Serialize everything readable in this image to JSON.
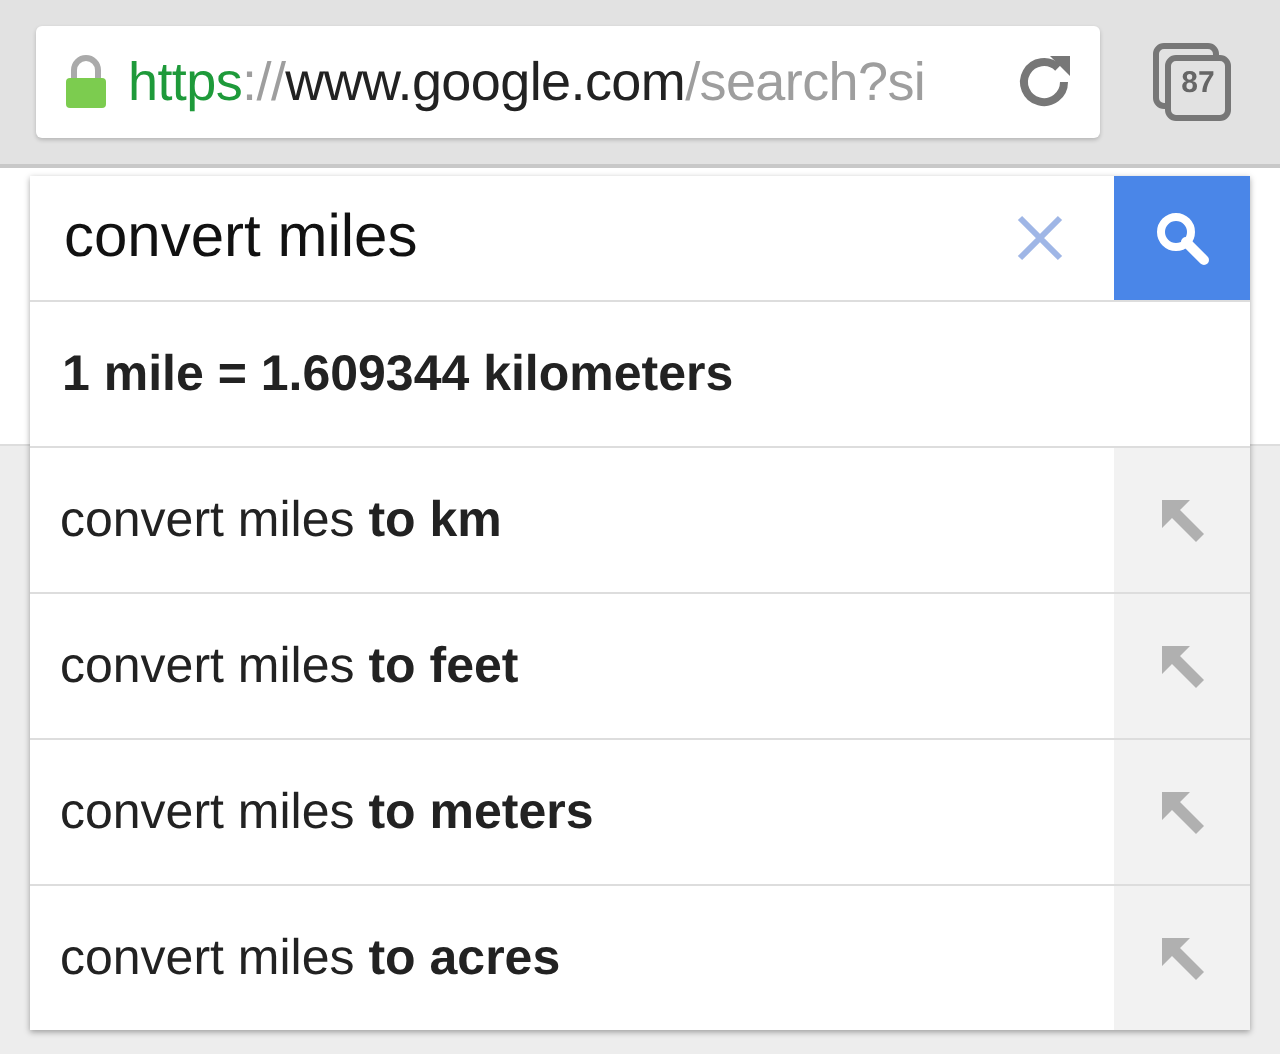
{
  "address_bar": {
    "url_parts": [
      {
        "kind": "scheme",
        "text": "https"
      },
      {
        "kind": "separator",
        "text": "://"
      },
      {
        "kind": "host",
        "text": "www.google.com"
      },
      {
        "kind": "path",
        "text": "/search?si"
      }
    ],
    "secure": true
  },
  "tab_count": "87",
  "search": {
    "value": "convert miles"
  },
  "answer": "1 mile = 1.609344 kilometers",
  "suggestions": [
    {
      "text": "convert miles **to km**"
    },
    {
      "text": "convert miles **to feet**"
    },
    {
      "text": "convert miles **to meters**"
    },
    {
      "text": "convert miles **to acres**"
    }
  ]
}
